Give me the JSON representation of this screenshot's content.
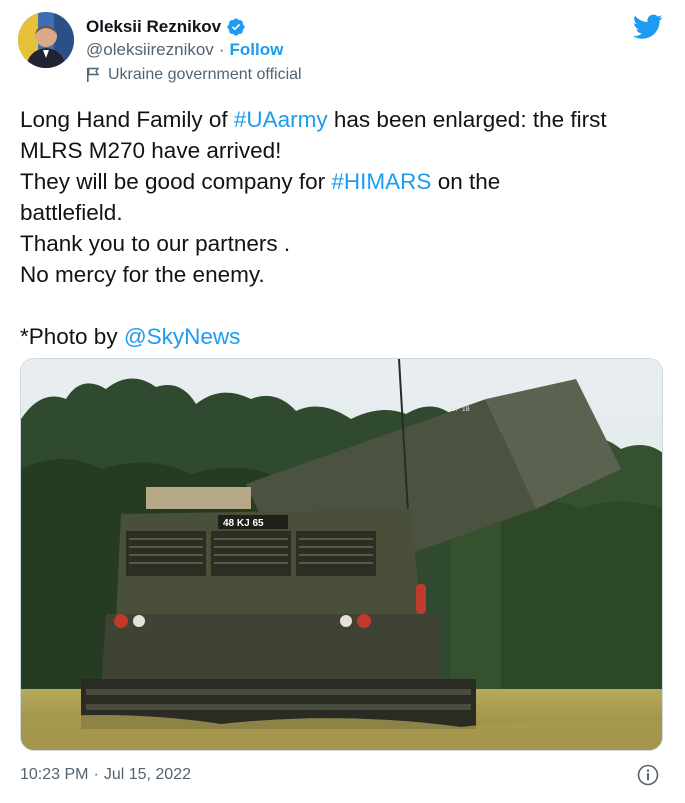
{
  "author": {
    "display_name": "Oleksii Reznikov",
    "handle": "@oleksiireznikov",
    "separator": "·",
    "follow_label": "Follow",
    "account_label": "Ukraine government official",
    "verified": true
  },
  "tweet": {
    "line1_pre": "Long Hand Family of ",
    "line1_tag": "#UAarmy",
    "line1_post": " has been enlarged: the first",
    "line2": "MLRS M270 have arrived!",
    "line3_pre": "They will be good company for ",
    "line3_tag": "#HIMARS",
    "line3_post": " on the",
    "line4": "battlefield.",
    "line5": "Thank you to our partners .",
    "line6": "No mercy for the enemy.",
    "credit_pre": "*Photo by ",
    "credit_mention": "@SkyNews"
  },
  "media": {
    "description_icon": "photo",
    "vehicle_plate": "48 KJ 65",
    "pod_marking": "SEP 18"
  },
  "footer": {
    "time": "10:23 PM",
    "separator": "·",
    "date": "Jul 15, 2022"
  },
  "icons": {
    "bird": "twitter-bird-icon",
    "verified": "verified-badge-icon",
    "flag": "flag-icon",
    "info": "info-icon"
  },
  "colors": {
    "accent": "#1d9bf0",
    "text": "#0f1419",
    "secondary": "#536471",
    "border": "#cfd9de"
  }
}
